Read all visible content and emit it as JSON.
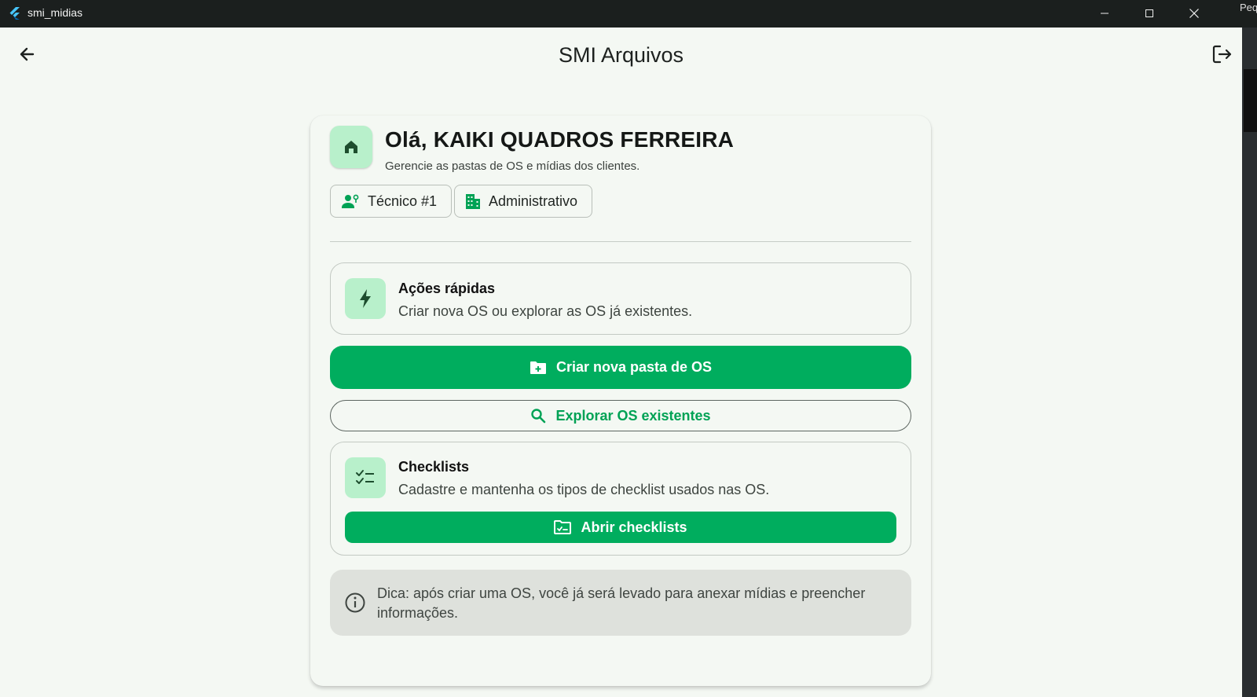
{
  "window": {
    "title": "smi_midias",
    "peek_text": "Peq"
  },
  "appbar": {
    "title": "SMI Arquivos"
  },
  "header": {
    "greeting": "Olá, KAIKI QUADROS FERREIRA",
    "subtitle": "Gerencie as pastas de OS e mídias dos clientes.",
    "chips": [
      {
        "label": "Técnico #1",
        "icon": "engineer-icon"
      },
      {
        "label": "Administrativo",
        "icon": "building-icon"
      }
    ]
  },
  "quick_actions": {
    "title": "Ações rápidas",
    "text": "Criar nova OS ou explorar as OS já existentes.",
    "create_label": "Criar nova pasta de OS",
    "explore_label": "Explorar OS existentes"
  },
  "checklists": {
    "title": "Checklists",
    "text": "Cadastre e mantenha os tipos de checklist usados nas OS.",
    "open_label": "Abrir checklists"
  },
  "tip": {
    "text": "Dica: após criar uma OS, você já será levado para anexar mídias e preencher informações."
  },
  "colors": {
    "accent": "#00ad5e",
    "badge": "#b8f0cb",
    "icon_dark": "#1d4d2e"
  }
}
